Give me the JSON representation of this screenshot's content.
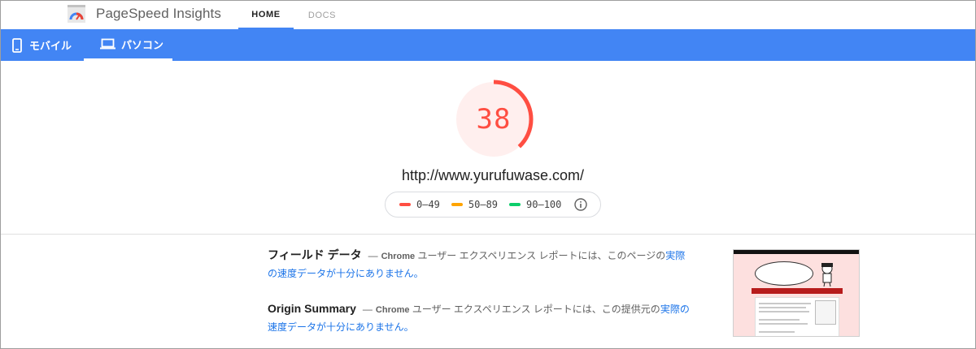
{
  "header": {
    "brand": "PageSpeed Insights",
    "tabs": [
      {
        "label": "HOME",
        "active": true
      },
      {
        "label": "DOCS",
        "active": false
      }
    ]
  },
  "device_tabs": [
    {
      "label": "モバイル",
      "icon": "smartphone-icon",
      "active": false
    },
    {
      "label": "パソコン",
      "icon": "laptop-icon",
      "active": true
    }
  ],
  "score": {
    "value": "38",
    "fraction": 0.38,
    "color": "#ff4e42",
    "bg_color": "#ffefee"
  },
  "url": "http://www.yurufuwase.com/",
  "legend": [
    {
      "range": "0–49",
      "color": "#ff4e42"
    },
    {
      "range": "50–89",
      "color": "#ffa400"
    },
    {
      "range": "90–100",
      "color": "#0cce6b"
    }
  ],
  "sections": {
    "field": {
      "title": "フィールド データ",
      "dash": "—",
      "source": "Chrome",
      "text": " ユーザー エクスペリエンス レポートには、このページの",
      "link": "実際の速度データが十分にありません。"
    },
    "origin": {
      "title": "Origin Summary",
      "dash": "—",
      "source": "Chrome",
      "text": " ユーザー エクスペリエンス レポートには、この提供元の",
      "link": "実際の速度データが十分にありません。"
    }
  },
  "colors": {
    "accent": "#4285f4",
    "link": "#1a73e8"
  }
}
